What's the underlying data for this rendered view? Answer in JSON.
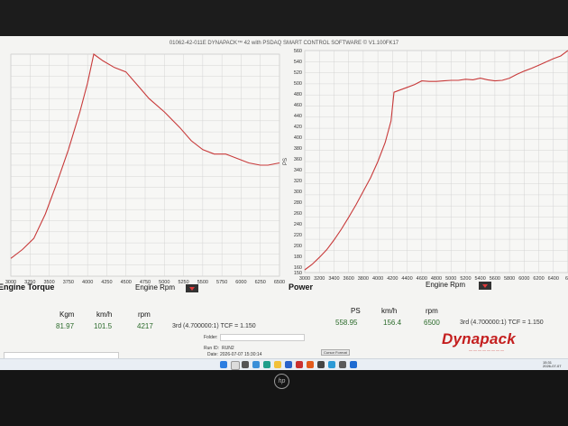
{
  "software_title": "01062-42-011E DYNAPACK™ 42 with PSDAQ SMART CONTROL SOFTWARE © V1.100FK17",
  "chart_data": [
    {
      "type": "line",
      "title": "Engine Torque",
      "xlabel": "Engine Rpm",
      "ylabel": "",
      "xlim": [
        3000,
        6500
      ],
      "x_ticks": [
        "3000",
        "3250",
        "3500",
        "3750",
        "4000",
        "4250",
        "4500",
        "4750",
        "5000",
        "5250",
        "5500",
        "5750",
        "6000",
        "6250",
        "6500"
      ],
      "series": [
        {
          "color": "#c83a3a",
          "x": [
            3000,
            3150,
            3300,
            3450,
            3600,
            3750,
            3900,
            4000,
            4080,
            4120,
            4200,
            4350,
            4500,
            4650,
            4800,
            5000,
            5200,
            5350,
            5500,
            5650,
            5800,
            5950,
            6100,
            6250,
            6350,
            6500
          ],
          "y": [
            0.08,
            0.12,
            0.17,
            0.28,
            0.42,
            0.57,
            0.74,
            0.87,
            1.0,
            0.99,
            0.97,
            0.94,
            0.92,
            0.86,
            0.8,
            0.74,
            0.67,
            0.61,
            0.57,
            0.55,
            0.55,
            0.53,
            0.51,
            0.5,
            0.5,
            0.51
          ]
        }
      ]
    },
    {
      "type": "line",
      "title": "Power",
      "xlabel": "Engine Rpm",
      "ylabel": "PS",
      "xlim": [
        3000,
        6600
      ],
      "ylim": [
        150,
        560
      ],
      "x_ticks": [
        "3000",
        "3200",
        "3400",
        "3600",
        "3800",
        "4000",
        "4200",
        "4400",
        "4600",
        "4800",
        "5000",
        "5200",
        "5400",
        "5600",
        "5800",
        "6000",
        "6200",
        "6400",
        "66"
      ],
      "y_ticks": [
        "150",
        "160",
        "180",
        "200",
        "220",
        "240",
        "260",
        "280",
        "300",
        "320",
        "340",
        "360",
        "380",
        "400",
        "420",
        "440",
        "460",
        "480",
        "500",
        "520",
        "540",
        "560"
      ],
      "series": [
        {
          "color": "#c83a3a",
          "x": [
            3000,
            3100,
            3200,
            3300,
            3400,
            3500,
            3600,
            3700,
            3800,
            3900,
            4000,
            4100,
            4180,
            4220,
            4300,
            4400,
            4500,
            4600,
            4700,
            4800,
            4900,
            5000,
            5100,
            5200,
            5300,
            5400,
            5500,
            5600,
            5700,
            5800,
            5900,
            6000,
            6100,
            6200,
            6300,
            6400,
            6500,
            6600
          ],
          "y": [
            155,
            165,
            178,
            192,
            210,
            230,
            252,
            275,
            300,
            325,
            355,
            390,
            430,
            483,
            487,
            492,
            497,
            504,
            503,
            503,
            504,
            505,
            505,
            507,
            506,
            509,
            506,
            504,
            505,
            509,
            516,
            522,
            527,
            533,
            539,
            545,
            550,
            560
          ]
        }
      ]
    }
  ],
  "readouts": {
    "torque": {
      "headers": [
        "Kgm",
        "km/h",
        "rpm"
      ],
      "values": [
        "81.97",
        "101.5",
        "4217"
      ],
      "gear": "3rd (4.700000:1) TCF = 1.150"
    },
    "power": {
      "headers": [
        "PS",
        "km/h",
        "rpm"
      ],
      "values": [
        "558.95",
        "156.4",
        "6500"
      ],
      "gear": "3rd (4.700000:1) TCF = 1.150"
    }
  },
  "footer": {
    "folder_label": "Folder:",
    "runid_label": "Run ID:",
    "runid_value": "RUN2",
    "date_label": "Date:",
    "date_value": "2026-07-07 15:30:14",
    "button_label": "Cursor Format"
  },
  "logo": {
    "text": "Dynapack",
    "color": "#c41f1f"
  },
  "taskbar": {
    "time": "15:31",
    "date": "2026-07-07"
  },
  "monitor_brand": "hp"
}
